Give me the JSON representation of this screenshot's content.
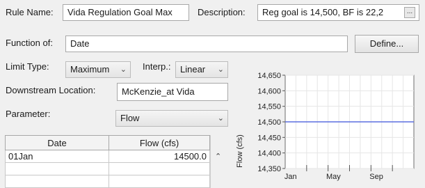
{
  "rule_name": {
    "label": "Rule Name:",
    "value": "Vida Regulation Goal Max"
  },
  "description": {
    "label": "Description:",
    "value": "Reg goal is 14,500, BF is 22,2",
    "button": "..."
  },
  "function_of": {
    "label": "Function of:",
    "value": "Date",
    "define_label": "Define..."
  },
  "limit_type": {
    "label": "Limit Type:",
    "value": "Maximum"
  },
  "interp": {
    "label": "Interp.:",
    "value": "Linear"
  },
  "downstream_location": {
    "label": "Downstream Location:",
    "value": "McKenzie_at Vida"
  },
  "parameter": {
    "label": "Parameter:",
    "value": "Flow"
  },
  "table": {
    "headers": [
      "Date",
      "Flow (cfs)"
    ],
    "rows": [
      [
        "01Jan",
        "14500.0"
      ],
      [
        "",
        ""
      ],
      [
        "",
        ""
      ]
    ]
  },
  "chart_data": {
    "type": "line",
    "ylabel": "Flow (cfs)",
    "xlabel": "",
    "ylim": [
      14350,
      14650
    ],
    "yticks": [
      14350,
      14400,
      14450,
      14500,
      14550,
      14600,
      14650
    ],
    "ytick_labels": [
      "14,350",
      "14,400",
      "14,450",
      "14,500",
      "14,550",
      "14,600",
      "14,650"
    ],
    "xticks": [
      "Jan",
      "May",
      "Sep"
    ],
    "grid": true,
    "series": [
      {
        "x": [
          "01Jan",
          "31Dec"
        ],
        "values": [
          14500,
          14500
        ],
        "color": "#5b6ee1"
      }
    ]
  }
}
